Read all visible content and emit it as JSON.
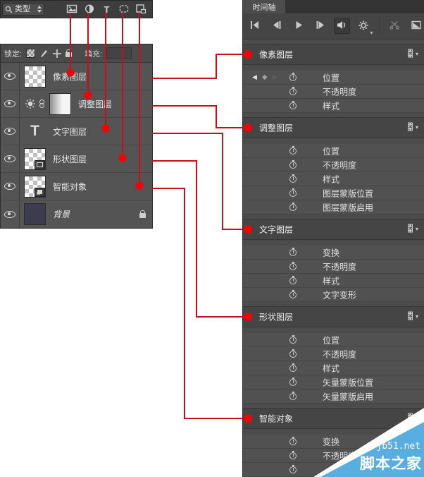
{
  "colors": {
    "connector_line": "#c3101f",
    "connector_dot": "#ee0505",
    "watermark_blue": "#58aede",
    "panel_bg": "#545454",
    "timeline_bg": "#4c4c4c"
  },
  "layers_panel": {
    "filter_label": "类型",
    "lock_label": "锁定:",
    "fill_label": "填充:",
    "filter_icons": [
      {
        "name": "pixel-layers-filter"
      },
      {
        "name": "adjustment-layers-filter"
      },
      {
        "name": "text-layers-filter",
        "glyph": "T"
      },
      {
        "name": "shape-layers-filter"
      },
      {
        "name": "smart-objects-filter"
      }
    ],
    "layers": [
      {
        "name": "像素图层",
        "thumb": "checker"
      },
      {
        "name": "调整图层",
        "thumb": "adjustment"
      },
      {
        "name": "文字图层",
        "thumb": "text",
        "glyph": "T"
      },
      {
        "name": "形状图层",
        "thumb": "shape"
      },
      {
        "name": "智能对象",
        "thumb": "smart"
      },
      {
        "name": "背景",
        "thumb": "background",
        "locked": true,
        "italic": true
      }
    ]
  },
  "timeline": {
    "tab": "时间轴",
    "toolbar": [
      {
        "name": "first-frame"
      },
      {
        "name": "previous-frame"
      },
      {
        "name": "play"
      },
      {
        "name": "next-frame"
      },
      {
        "name": "audio",
        "pressed": true
      },
      {
        "name": "settings",
        "has_caret": true
      },
      {
        "name": "scissors",
        "disabled": true,
        "sep_before": true
      },
      {
        "name": "transition"
      }
    ],
    "kf_icons": {
      "prev": "◀",
      "diamond": "◆",
      "next": "▶"
    },
    "caret": "▾",
    "tracks": [
      {
        "name": "像素图层",
        "props": [
          {
            "label": "位置",
            "nav": true
          },
          {
            "label": "不透明度"
          },
          {
            "label": "样式"
          }
        ]
      },
      {
        "name": "调整图层",
        "props": [
          {
            "label": "位置"
          },
          {
            "label": "不透明度"
          },
          {
            "label": "样式"
          },
          {
            "label": "图层蒙版位置"
          },
          {
            "label": "图层蒙版启用"
          }
        ]
      },
      {
        "name": "文字图层",
        "props": [
          {
            "label": "变换"
          },
          {
            "label": "不透明度"
          },
          {
            "label": "样式"
          },
          {
            "label": "文字变形"
          }
        ]
      },
      {
        "name": "形状图层",
        "props": [
          {
            "label": "位置"
          },
          {
            "label": "不透明度"
          },
          {
            "label": "样式"
          },
          {
            "label": "矢量蒙版位置"
          },
          {
            "label": "矢量蒙版启用"
          }
        ]
      },
      {
        "name": "智能对象",
        "props": [
          {
            "label": "变换"
          },
          {
            "label": "不透明度"
          },
          {
            "label": ""
          }
        ]
      }
    ]
  },
  "watermark": {
    "site": "jb51.net",
    "name": "脚本之家"
  }
}
